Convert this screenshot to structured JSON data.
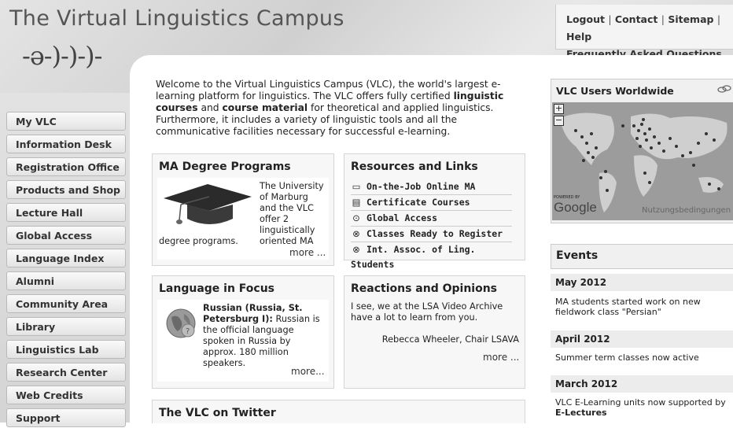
{
  "site": {
    "title": "The Virtual Linguistics Campus",
    "logo_text": "-ə-)-)-)-"
  },
  "top_links": {
    "logout": "Logout",
    "contact": "Contact",
    "sitemap": "Sitemap",
    "help": "Help",
    "faq": "Frequently Asked Questions",
    "sep": "|"
  },
  "sidebar": {
    "items": [
      "My VLC",
      "Information Desk",
      "Registration Office",
      "Products and Shop",
      "Lecture Hall",
      "Global Access",
      "Language Index",
      "Alumni",
      "Community Area",
      "Library",
      "Linguistics Lab",
      "Research Center",
      "Web Credits",
      "Support"
    ]
  },
  "intro": {
    "p1": "Welcome to the Virtual Linguistics Campus (VLC), the world's largest e-learning platform for linguistics. The VLC offers fully certified ",
    "b1": "linguistic courses",
    "p2": " and ",
    "b2": "course material",
    "p3": " for theoretical and applied linguistics. Furthermore, it includes a variety of linguistic tools and all the communicative facilities necessary for successful e-learning."
  },
  "ma": {
    "title": "MA Degree Programs",
    "text": "The University of Marburg and the VLC offer 2 linguistically oriented MA",
    "text2": "degree programs.",
    "more": "more ..."
  },
  "resources": {
    "title": "Resources and Links",
    "items": [
      {
        "label": "On-the-Job Online MA",
        "icon": "monitor-icon",
        "glyph": "▭"
      },
      {
        "label": "Certificate Courses",
        "icon": "certificate-icon",
        "glyph": "▤"
      },
      {
        "label": "Global Access",
        "icon": "global-access-icon",
        "glyph": "⊙"
      },
      {
        "label": "Classes Ready to Register",
        "icon": "compass-icon",
        "glyph": "⊗"
      },
      {
        "label": "Int. Assoc. of Ling. Students",
        "icon": "compass-icon",
        "glyph": "⊗"
      }
    ]
  },
  "language_focus": {
    "title": "Language in Focus",
    "bold": "Russian (Russia, St. Petersburg I):",
    "text": " Russian is the official language spoken in Russia by approx. 180 million speakers.",
    "more": "more..."
  },
  "reactions": {
    "title": "Reactions and Opinions",
    "quote": "I see, we at the LSA Video Archive have a lot to learn from you.",
    "author": "Rebecca Wheeler, Chair LSAVA",
    "more": "more ..."
  },
  "twitter": {
    "title": "The VLC on Twitter"
  },
  "map": {
    "title": "VLC Users Worldwide",
    "zoom_in": "+",
    "zoom_out": "−",
    "powered_by": "POWERED BY",
    "google": "Google",
    "terms": "Nutzungsbedingungen"
  },
  "events": {
    "title": "Events",
    "items": [
      {
        "date": "May 2012",
        "text": "MA students started work on new fieldwork class \"Persian\""
      },
      {
        "date": "April 2012",
        "text": "Summer term classes now active"
      },
      {
        "date": "March 2012",
        "text": "VLC E-Learning units now supported by ",
        "bold": "E-Lectures"
      }
    ]
  }
}
